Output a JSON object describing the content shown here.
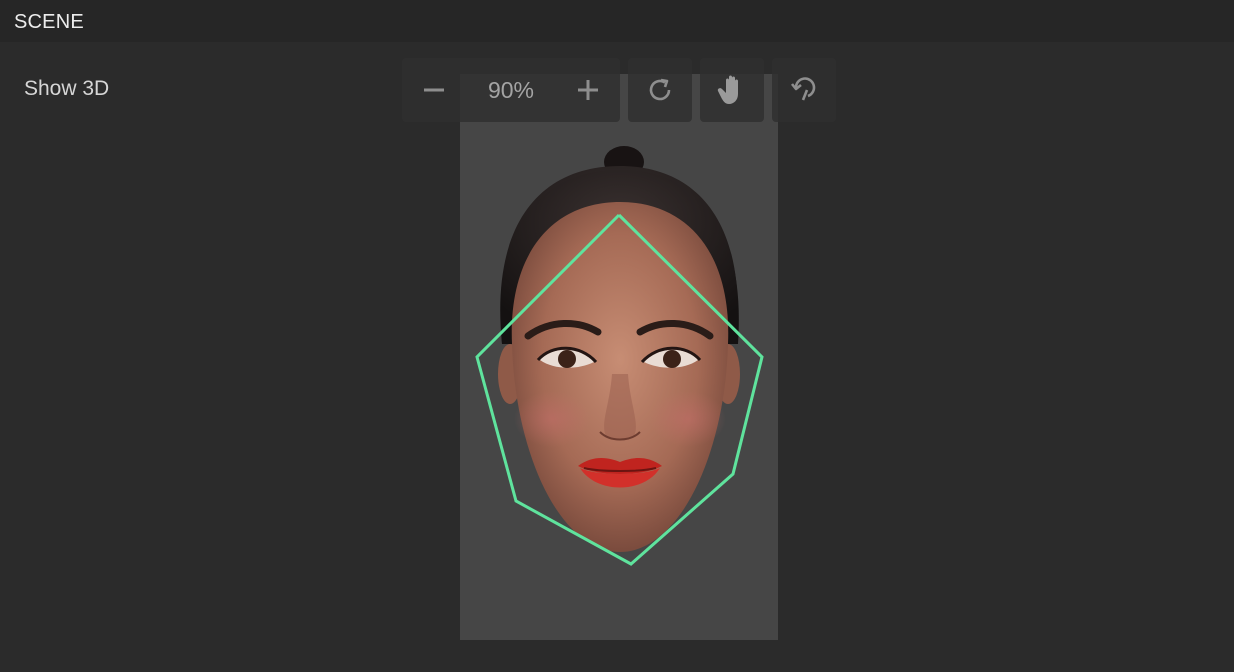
{
  "panel": {
    "title": "SCENE"
  },
  "viewport": {
    "show3d_label": "Show 3D",
    "zoom": {
      "value": "90%"
    },
    "icons": {
      "zoom_out": "minus-icon",
      "zoom_in": "plus-icon",
      "reset": "refresh-icon",
      "pan": "hand-icon",
      "rotate": "rotate-3d-icon"
    },
    "overlay_color": "#5fe39d"
  }
}
